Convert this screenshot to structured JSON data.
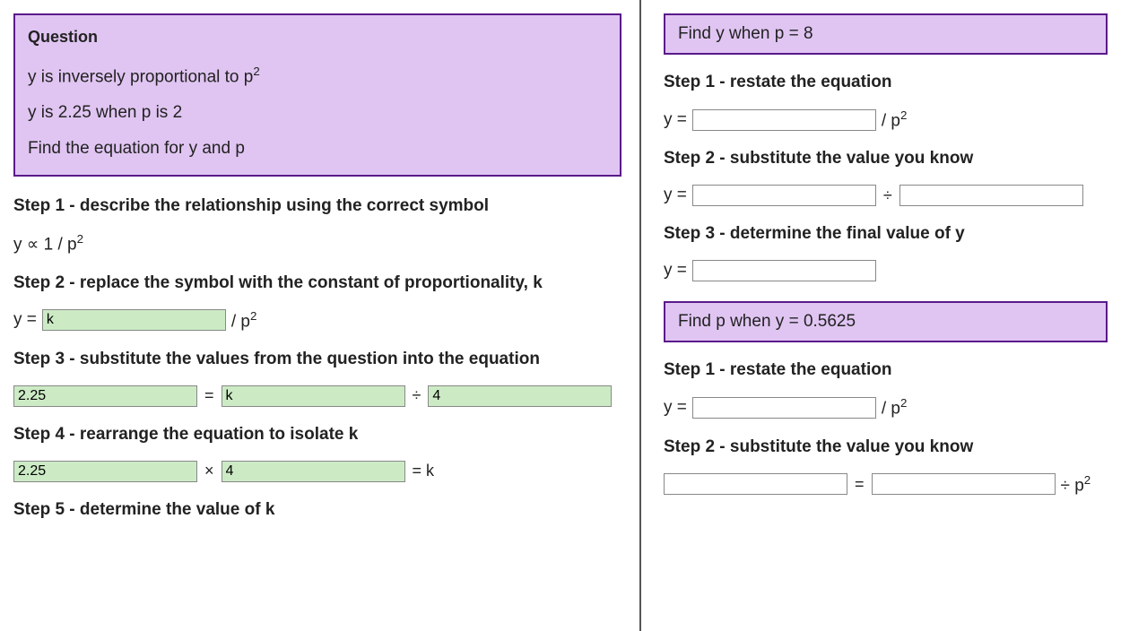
{
  "left": {
    "question_title": "Question",
    "q_lines": [
      "y is inversely proportional to p",
      "y is 2.25 when p is 2",
      "Find the equation for y and p"
    ],
    "q_line0_sup": "2",
    "step1": "Step 1 - describe the relationship using the correct symbol",
    "step1_expr_pre": "y ∝ 1 / p",
    "step1_expr_sup": "2",
    "step2": "Step 2 - replace the symbol with the constant of proportionality, k",
    "step2_prefix": "y =",
    "step2_input": "k",
    "step2_suffix_pre": "/ p",
    "step2_suffix_sup": "2",
    "step3": "Step 3 - substitute the values from the question into the equation",
    "step3_v1": "2.25",
    "step3_eq": " = ",
    "step3_v2": "k",
    "step3_div": " ÷ ",
    "step3_v3": "4",
    "step4": "Step 4 - rearrange the equation to isolate k",
    "step4_v1": "2.25",
    "step4_times": " × ",
    "step4_v2": "4",
    "step4_eqk": " = k",
    "step5": "Step 5 - determine the value of k"
  },
  "right": {
    "box1": "Find y when p = 8",
    "r1_step1": "Step 1 - restate the equation",
    "r1_eq_prefix": "y =",
    "r1_eq_suffix_pre": "/ p",
    "r1_eq_suffix_sup": "2",
    "r1_step2": "Step 2 - substitute the value you know",
    "r1_s2_prefix": "y =",
    "r1_s2_div": " ÷ ",
    "r1_step3": "Step 3 - determine the final value of y",
    "r1_s3_prefix": "y =",
    "box2": "Find p when y = 0.5625",
    "r2_step1": "Step 1 - restate the equation",
    "r2_eq_prefix": "y =",
    "r2_eq_suffix_pre": "/ p",
    "r2_eq_suffix_sup": "2",
    "r2_step2": "Step 2 - substitute the value you know",
    "r2_s2_eq": " = ",
    "r2_s2_div_pre": " ÷ p",
    "r2_s2_div_sup": "2"
  }
}
